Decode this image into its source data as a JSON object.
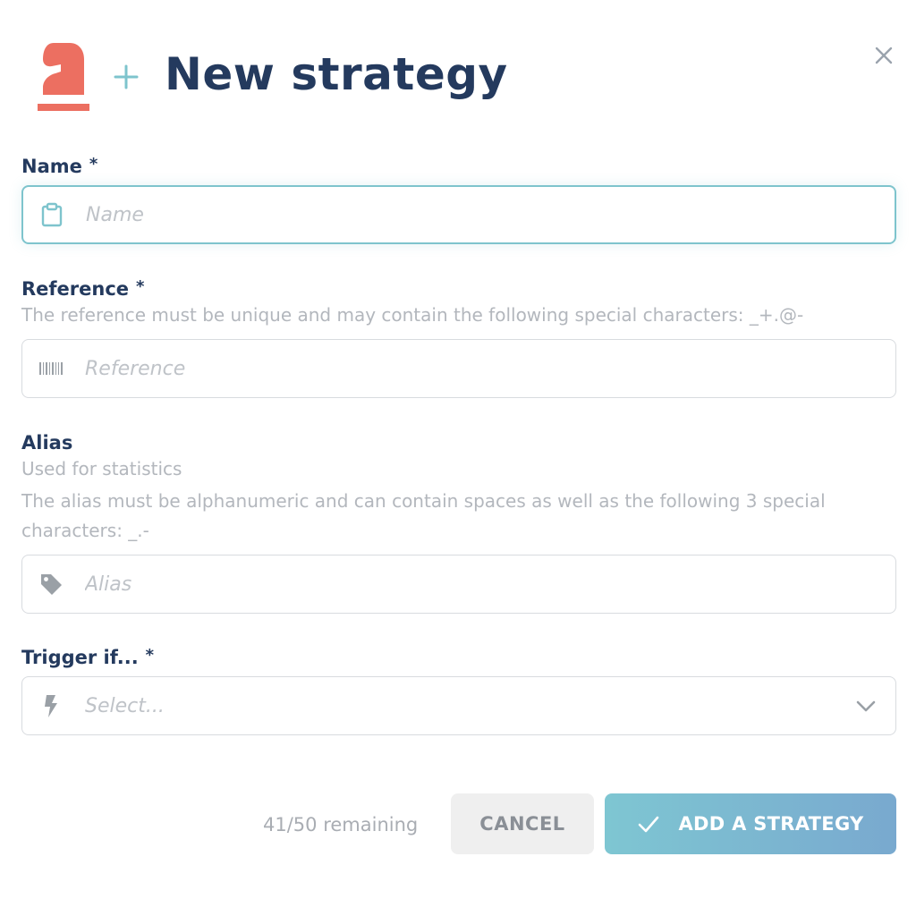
{
  "header": {
    "title": "New strategy",
    "logo_icon": "chess-knight-icon",
    "plus_icon": "plus-icon",
    "close_icon": "close-icon"
  },
  "colors": {
    "primary": "#243a5e",
    "accent": "#7ec4cd",
    "logo": "#ec6f61",
    "muted": "#b3b7bd"
  },
  "fields": {
    "name": {
      "label": "Name",
      "required_marker": "*",
      "placeholder": "Name",
      "value": "",
      "icon": "clipboard-icon"
    },
    "reference": {
      "label": "Reference",
      "required_marker": "*",
      "help": "The reference must be unique and may contain the following special characters: _+.@-",
      "placeholder": "Reference",
      "value": "",
      "icon": "barcode-icon"
    },
    "alias": {
      "label": "Alias",
      "help_1": "Used for statistics",
      "help_2": "The alias must be alphanumeric and can contain spaces as well as the following 3 special characters: _.-",
      "placeholder": "Alias",
      "value": "",
      "icon": "tag-icon"
    },
    "trigger": {
      "label": "Trigger if...",
      "required_marker": "*",
      "placeholder": "Select...",
      "icon": "bolt-icon",
      "dropdown_icon": "chevron-down-icon"
    }
  },
  "footer": {
    "remaining": "41/50 remaining",
    "cancel_label": "CANCEL",
    "submit_label": "ADD A STRATEGY",
    "submit_icon": "check-icon"
  }
}
